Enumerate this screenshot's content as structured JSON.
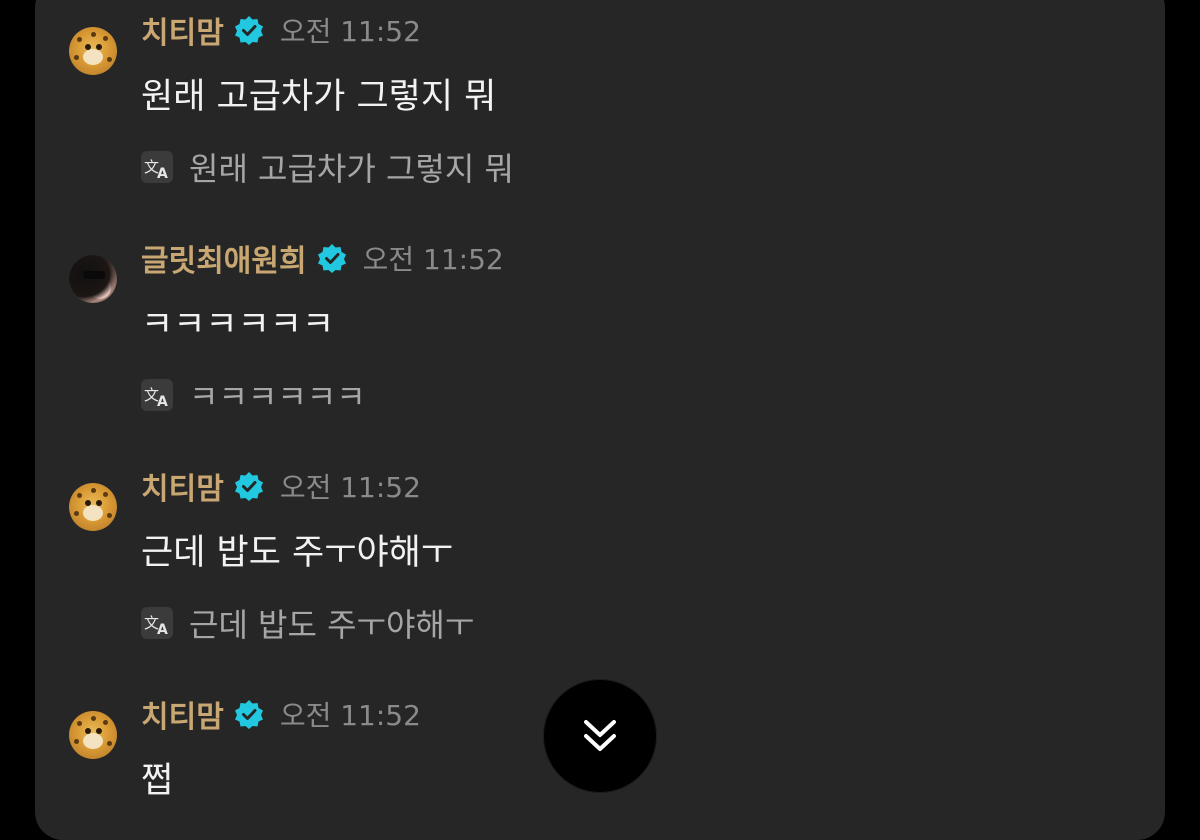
{
  "messages": [
    {
      "username": "치티맘",
      "time": "오전 11:52",
      "text": "원래 고급차가 그렇지 뭐",
      "translation": "원래 고급차가 그렇지 뭐",
      "avatar": "cheetah-avatar"
    },
    {
      "username": "글릿최애원희",
      "time": "오전 11:52",
      "text": "ㅋㅋㅋㅋㅋㅋ",
      "translation": "ㅋㅋㅋㅋㅋㅋ",
      "avatar": "girl-avatar"
    },
    {
      "username": "치티맘",
      "time": "오전 11:52",
      "text": "근데 밥도 주ㅜ야해ㅜ",
      "translation": "근데 밥도 주ㅜ야해ㅜ",
      "avatar": "cheetah-avatar"
    },
    {
      "username": "치티맘",
      "time": "오전 11:52",
      "text": "쩝",
      "avatar": "cheetah-avatar"
    }
  ],
  "icons": {
    "verified": "verified-badge-icon",
    "translate": "translate-icon",
    "scroll_down": "double-chevron-down-icon"
  },
  "colors": {
    "background": "#000000",
    "panel": "#262626",
    "username": "#c9a772",
    "verified": "#21c8e0",
    "time": "#8a8a8a",
    "text": "#f2f2f2",
    "translation": "#a6a6a6"
  }
}
